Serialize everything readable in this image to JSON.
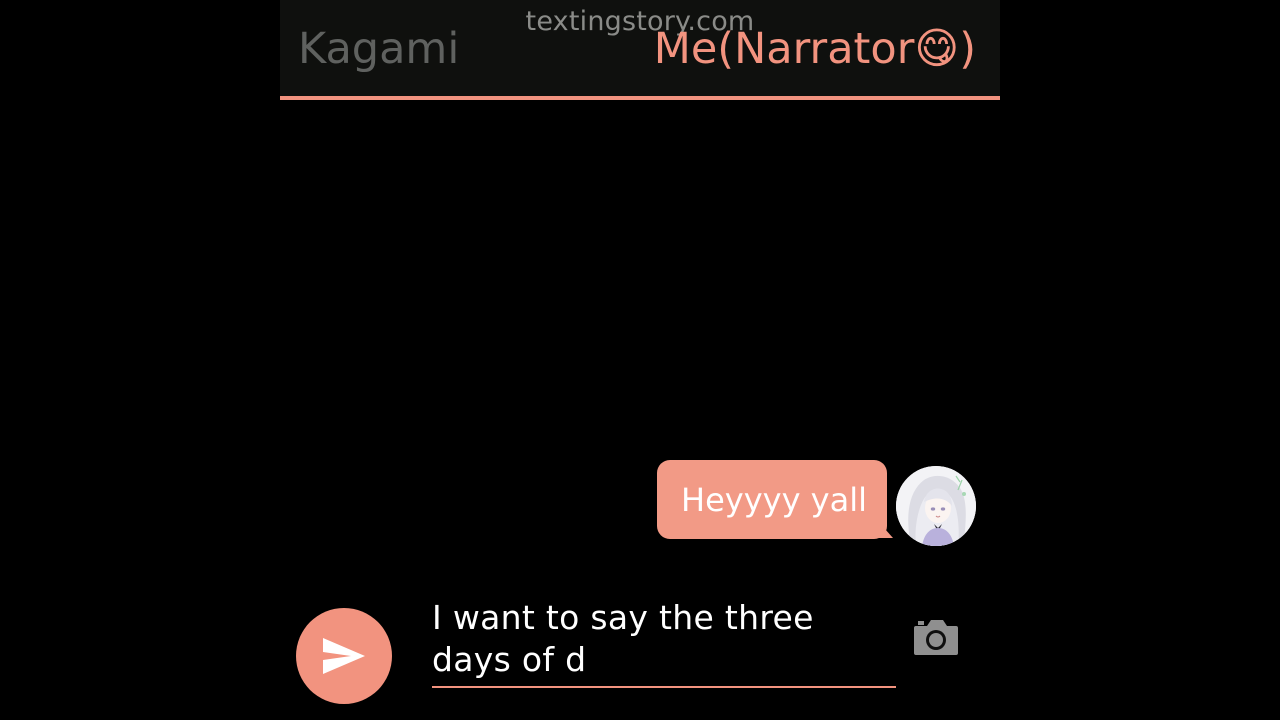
{
  "header": {
    "watermark": "textingstory.com",
    "left_tab": "Kagami",
    "right_tab": "Me(Narrator😋)"
  },
  "messages": [
    {
      "text": "Heyyyy yall",
      "sender": "Me"
    }
  ],
  "composer": {
    "value": "I want to say the three days of d",
    "send_icon": "send-icon",
    "camera_icon": "camera-icon"
  },
  "colors": {
    "accent": "#f2937f",
    "bubble": "#f29a86",
    "header_bg": "#0f100e",
    "background": "#000000",
    "muted": "#5f615f"
  }
}
